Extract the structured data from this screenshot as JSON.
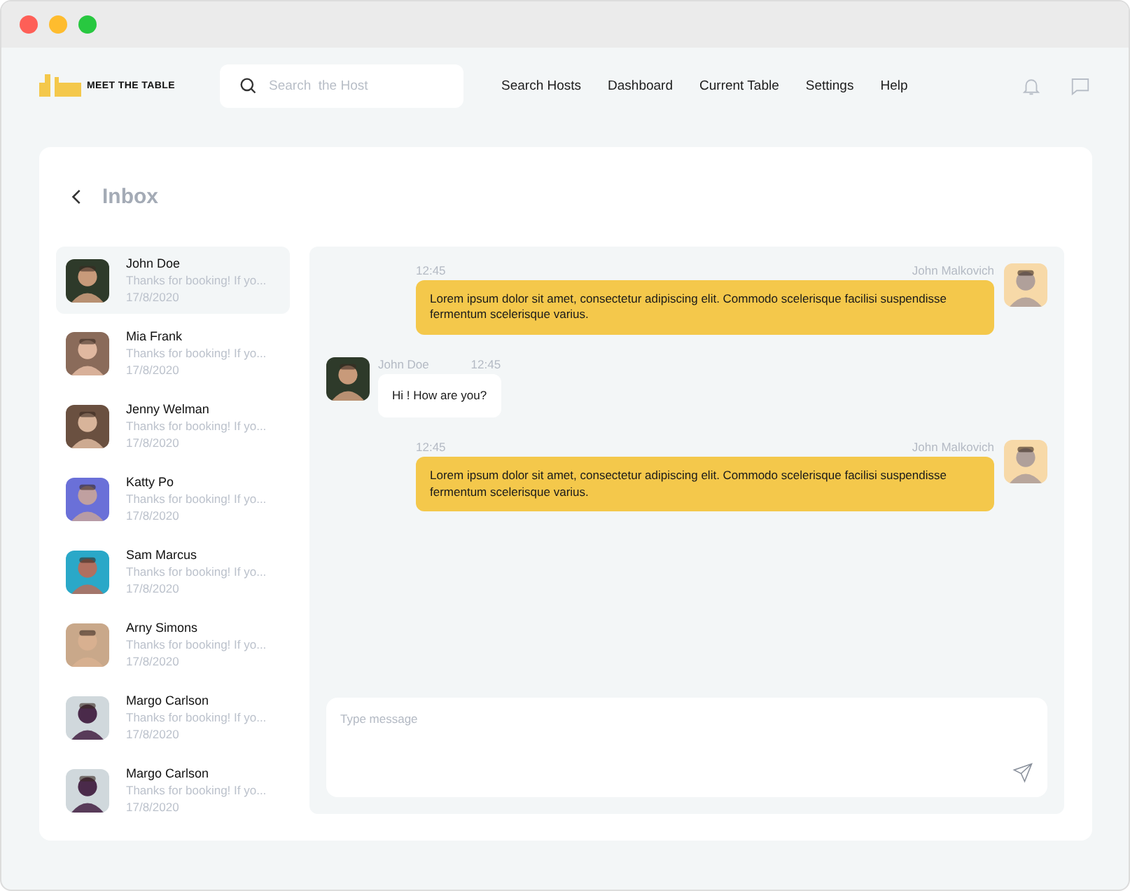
{
  "brand": {
    "name": "MEET THE TABLE"
  },
  "search": {
    "placeholder": "Search  the Host"
  },
  "nav": [
    {
      "label": "Search Hosts"
    },
    {
      "label": "Dashboard"
    },
    {
      "label": "Current Table"
    },
    {
      "label": "Settings"
    },
    {
      "label": "Help"
    }
  ],
  "inbox": {
    "title": "Inbox"
  },
  "contacts": [
    {
      "name": "John Doe",
      "preview": "Thanks for booking! If yo...",
      "date": "17/8/2020",
      "selected": true
    },
    {
      "name": "Mia Frank",
      "preview": "Thanks for booking! If yo...",
      "date": "17/8/2020",
      "selected": false
    },
    {
      "name": "Jenny Welman",
      "preview": "Thanks for booking! If yo...",
      "date": "17/8/2020",
      "selected": false
    },
    {
      "name": "Katty Po",
      "preview": "Thanks for booking! If yo...",
      "date": "17/8/2020",
      "selected": false
    },
    {
      "name": "Sam Marcus",
      "preview": "Thanks for booking! If yo...",
      "date": "17/8/2020",
      "selected": false
    },
    {
      "name": "Arny Simons",
      "preview": "Thanks for booking! If yo...",
      "date": "17/8/2020",
      "selected": false
    },
    {
      "name": "Margo Carlson",
      "preview": "Thanks for booking! If yo...",
      "date": "17/8/2020",
      "selected": false
    },
    {
      "name": "Margo Carlson",
      "preview": "Thanks for booking! If yo...",
      "date": "17/8/2020",
      "selected": false
    }
  ],
  "messages": [
    {
      "kind": "outgoing",
      "sender": "John Malkovich",
      "time": "12:45",
      "text": "Lorem ipsum dolor sit amet, consectetur adipiscing elit. Commodo scelerisque facilisi suspendisse fermentum scelerisque varius."
    },
    {
      "kind": "incoming",
      "sender": "John Doe",
      "time": "12:45",
      "text": "Hi ! How are you?"
    },
    {
      "kind": "outgoing",
      "sender": "John Malkovich",
      "time": "12:45",
      "text": "Lorem ipsum dolor sit amet, consectetur adipiscing elit. Commodo scelerisque facilisi suspendisse fermentum scelerisque varius."
    }
  ],
  "composer": {
    "placeholder": "Type message"
  }
}
